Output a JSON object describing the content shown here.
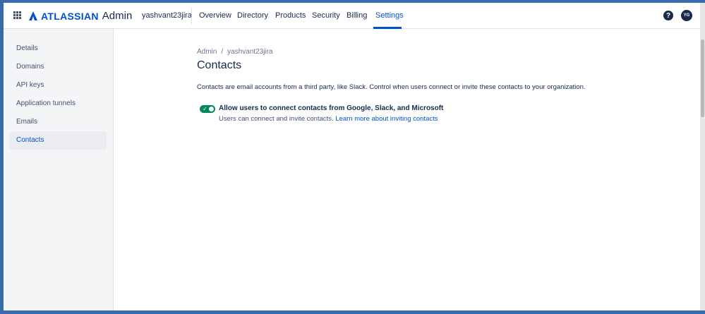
{
  "topnav": {
    "brand_word": "ATLASSIAN",
    "brand_product": "Admin",
    "org_name": "yashvant23jira",
    "items": [
      {
        "label": "Overview"
      },
      {
        "label": "Directory"
      },
      {
        "label": "Products"
      },
      {
        "label": "Security"
      },
      {
        "label": "Billing"
      },
      {
        "label": "Settings"
      }
    ],
    "active": "Settings",
    "help_glyph": "?",
    "avatar_initials": "YG"
  },
  "sidebar": {
    "items": [
      {
        "label": "Details"
      },
      {
        "label": "Domains"
      },
      {
        "label": "API keys"
      },
      {
        "label": "Application tunnels"
      },
      {
        "label": "Emails"
      },
      {
        "label": "Contacts"
      }
    ],
    "active": "Contacts"
  },
  "main": {
    "breadcrumb": {
      "root": "Admin",
      "separator": "/",
      "org": "yashvant23jira"
    },
    "title": "Contacts",
    "description": "Contacts are email accounts from a third party, like Slack. Control when users connect or invite these contacts to your organization.",
    "toggle": {
      "state": "on",
      "label": "Allow users to connect contacts from Google, Slack, and Microsoft",
      "help_text": "Users can connect and invite contacts.",
      "help_link": "Learn more about inviting contacts"
    }
  },
  "colors": {
    "brand": "#0052cc",
    "toggle_on": "#00875a",
    "text": "#172b4d"
  }
}
